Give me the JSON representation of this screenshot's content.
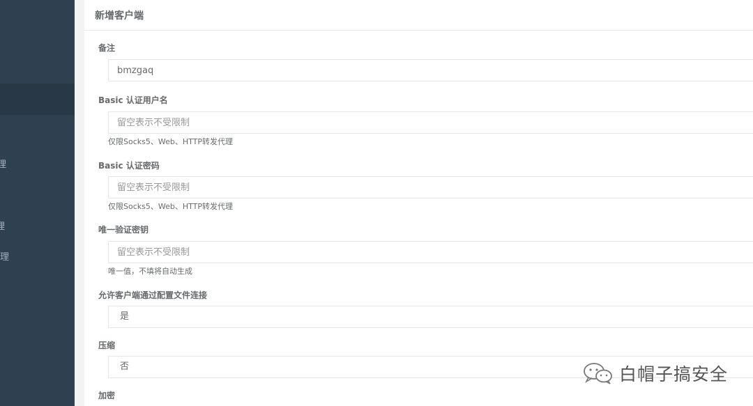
{
  "sidebar": {
    "items": [
      {
        "label": "理"
      },
      {
        "label": "理"
      },
      {
        "label": "理"
      }
    ]
  },
  "form": {
    "title": "新增客户端",
    "remark": {
      "label": "备注",
      "value": "bmzgaq"
    },
    "basic_user": {
      "label": "Basic 认证用户名",
      "placeholder": "留空表示不受限制",
      "help": "仅限Socks5、Web、HTTP转发代理"
    },
    "basic_pass": {
      "label": "Basic 认证密码",
      "placeholder": "留空表示不受限制",
      "help": "仅限Socks5、Web、HTTP转发代理"
    },
    "vkey": {
      "label": "唯一验证密钥",
      "placeholder": "留空表示不受限制",
      "help": "唯一值，不填将自动生成"
    },
    "config_conn": {
      "label": "允许客户端通过配置文件连接",
      "value": "是"
    },
    "compress": {
      "label": "压缩",
      "value": "否"
    },
    "crypt": {
      "label": "加密"
    }
  },
  "watermark": {
    "text": "白帽子搞安全",
    "icon": "wechat-icon"
  }
}
